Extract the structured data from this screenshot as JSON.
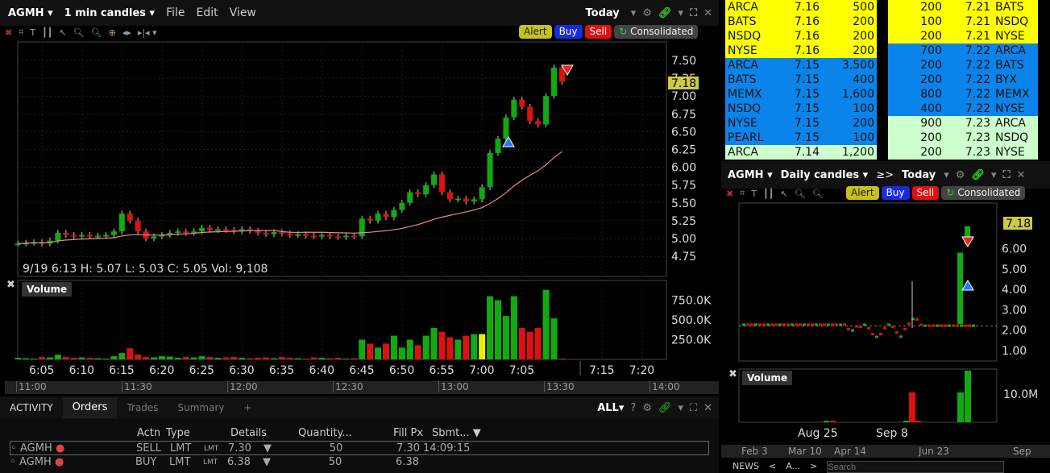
{
  "main": {
    "symbol": "AGMH",
    "interval": "1 min candles",
    "menus": [
      "File",
      "Edit",
      "View"
    ],
    "range": "Today",
    "alert": "Alert",
    "buy": "Buy",
    "sell": "Sell",
    "consolidated": "Consolidated",
    "last": "7.18",
    "price_ticks": [
      "7.50",
      "7.25",
      "7.00",
      "6.75",
      "6.50",
      "6.25",
      "6.00",
      "5.75",
      "5.50",
      "5.25",
      "5.00",
      "4.75"
    ],
    "info": "9/19 6:13  H: 5.07  L: 5.03  C: 5.05  Vol: 9,108",
    "volume_label": "Volume",
    "vol_ticks": [
      "750.0K",
      "500.0K",
      "250.0K"
    ],
    "time_ticks": [
      "6:05",
      "6:10",
      "6:15",
      "6:20",
      "6:25",
      "6:30",
      "6:35",
      "6:40",
      "6:45",
      "6:50",
      "6:55",
      "7:00",
      "7:05",
      "7:15",
      "7:20"
    ],
    "nav_ticks": [
      "11:00",
      "11:30",
      "12:00",
      "12:30",
      "13:00",
      "13:30",
      "14:00"
    ]
  },
  "chart_data": {
    "type": "candlestick",
    "start": "6:02",
    "interval_min": 1,
    "close": [
      4.93,
      4.94,
      4.95,
      4.93,
      4.97,
      5.08,
      5.05,
      5.03,
      5.05,
      5.03,
      5.04,
      5.05,
      5.1,
      5.35,
      5.25,
      5.1,
      5.0,
      5.03,
      5.05,
      5.08,
      5.1,
      5.08,
      5.1,
      5.15,
      5.12,
      5.13,
      5.12,
      5.1,
      5.13,
      5.11,
      5.08,
      5.06,
      5.09,
      5.07,
      5.05,
      5.06,
      5.04,
      5.03,
      5.05,
      5.03,
      5.02,
      5.04,
      5.03,
      5.28,
      5.25,
      5.35,
      5.3,
      5.4,
      5.5,
      5.65,
      5.62,
      5.75,
      5.9,
      5.65,
      5.55,
      5.56,
      5.52,
      5.55,
      5.72,
      6.2,
      6.4,
      6.7,
      6.95,
      6.85,
      6.65,
      6.6,
      7.0,
      7.4,
      7.2
    ],
    "volume_k": [
      20,
      15,
      10,
      30,
      25,
      60,
      30,
      20,
      25,
      20,
      15,
      10,
      40,
      80,
      140,
      60,
      30,
      25,
      40,
      35,
      20,
      30,
      25,
      40,
      30,
      20,
      25,
      30,
      20,
      15,
      20,
      25,
      15,
      30,
      20,
      15,
      10,
      25,
      20,
      15,
      20,
      10,
      15,
      250,
      200,
      150,
      200,
      300,
      150,
      250,
      180,
      300,
      400,
      350,
      280,
      250,
      300,
      320,
      320,
      800,
      750,
      550,
      800,
      400,
      350,
      400,
      880,
      520,
      10
    ],
    "ylim": [
      4.6,
      7.65
    ]
  },
  "book": {
    "bids": [
      [
        "ARCA",
        "7.16",
        "500",
        "y"
      ],
      [
        "BATS",
        "7.16",
        "200",
        "y"
      ],
      [
        "NSDQ",
        "7.16",
        "200",
        "y"
      ],
      [
        "NYSE",
        "7.16",
        "200",
        "y"
      ],
      [
        "ARCA",
        "7.15",
        "3,500",
        "b"
      ],
      [
        "BATS",
        "7.15",
        "400",
        "b"
      ],
      [
        "MEMX",
        "7.15",
        "1,600",
        "b"
      ],
      [
        "NSDQ",
        "7.15",
        "100",
        "b"
      ],
      [
        "NYSE",
        "7.15",
        "200",
        "b"
      ],
      [
        "PEARL",
        "7.15",
        "100",
        "b"
      ],
      [
        "ARCA",
        "7.14",
        "1,200",
        "g"
      ]
    ],
    "asks": [
      [
        "200",
        "7.21",
        "BATS",
        "y"
      ],
      [
        "100",
        "7.21",
        "NSDQ",
        "y"
      ],
      [
        "200",
        "7.21",
        "NYSE",
        "y"
      ],
      [
        "700",
        "7.22",
        "ARCA",
        "b"
      ],
      [
        "200",
        "7.22",
        "BATS",
        "b"
      ],
      [
        "200",
        "7.22",
        "BYX",
        "b"
      ],
      [
        "800",
        "7.22",
        "MEMX",
        "b"
      ],
      [
        "400",
        "7.22",
        "NYSE",
        "b"
      ],
      [
        "900",
        "7.23",
        "ARCA",
        "g"
      ],
      [
        "200",
        "7.23",
        "NSDQ",
        "g"
      ],
      [
        "200",
        "7.23",
        "NYSE",
        "g"
      ]
    ]
  },
  "daily": {
    "symbol": "AGMH",
    "interval": "Daily candles",
    "range": "Today",
    "last": "7.18",
    "price_ticks": [
      "6.00",
      "5.00",
      "4.00",
      "3.00",
      "2.00",
      "1.00"
    ],
    "volume_label": "Volume",
    "vol_tick": "10.0M",
    "time_ticks": [
      "Aug 25",
      "Sep 8"
    ],
    "nav_ticks": [
      "Feb 3",
      "Mar 10",
      "Apr 14",
      "Jun 23",
      "Sep"
    ],
    "news": "NEWS",
    "news_tab": "A...",
    "search_placeholder": "Search"
  },
  "activity": {
    "title": "ACTIVITY",
    "tabs": [
      "Orders",
      "Trades",
      "Summary"
    ],
    "filter": "ALL",
    "columns": [
      "Actn",
      "Type",
      "Details",
      "Quantity...",
      "Fill Px",
      "Sbmt..."
    ],
    "orders": [
      {
        "sym": "AGMH",
        "actn": "SELL",
        "type": "LMT",
        "det_t": "LMT",
        "det": "7.30",
        "qty": "50",
        "fill": "7.30",
        "time": "14:09:15"
      },
      {
        "sym": "AGMH",
        "actn": "BUY",
        "type": "LMT",
        "det_t": "LMT",
        "det": "6.38",
        "qty": "50",
        "fill": "6.38",
        "time": ""
      }
    ]
  }
}
